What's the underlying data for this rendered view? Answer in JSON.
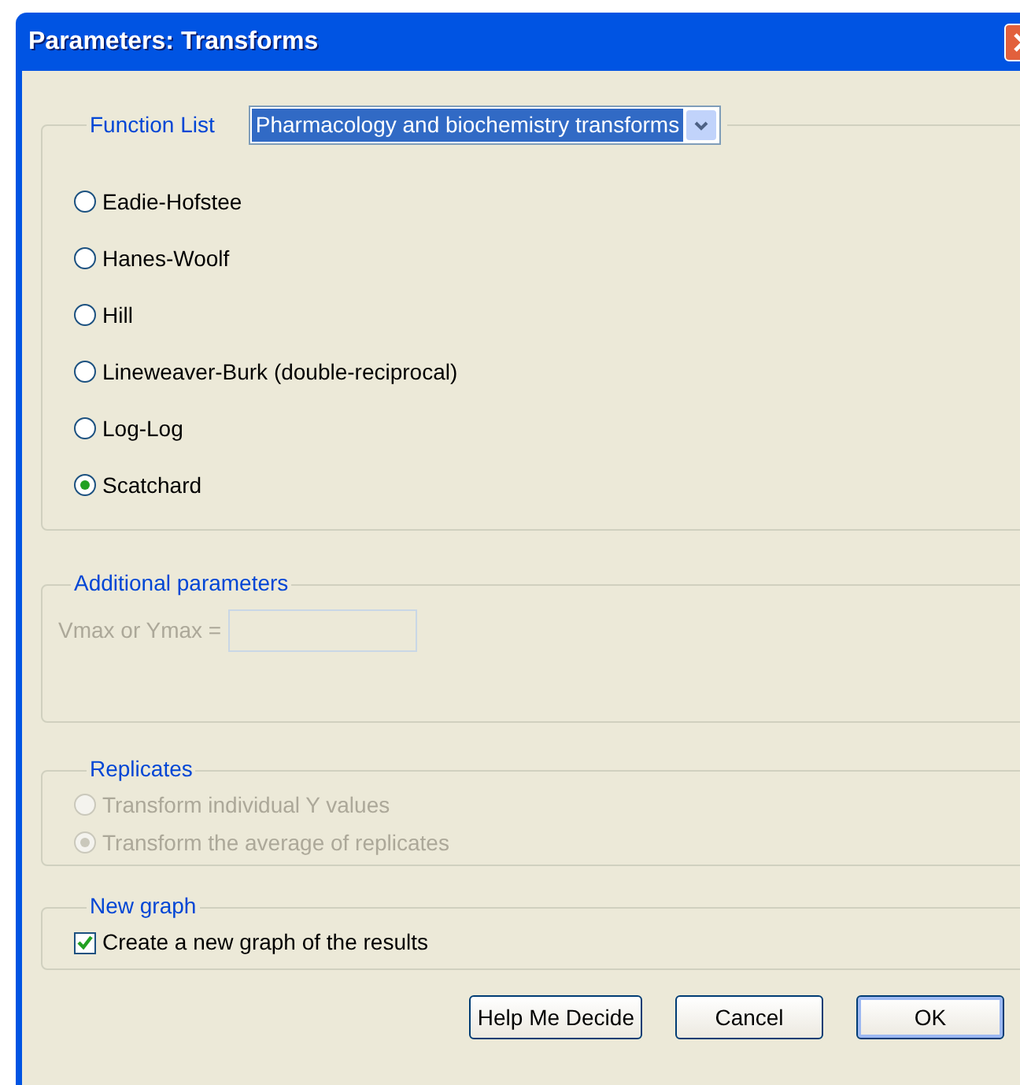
{
  "window": {
    "title": "Parameters: Transforms"
  },
  "function_list": {
    "label": "Function List",
    "value": "Pharmacology and biochemistry transforms"
  },
  "transforms": [
    {
      "label": "Eadie-Hofstee",
      "selected": false
    },
    {
      "label": "Hanes-Woolf",
      "selected": false
    },
    {
      "label": "Hill",
      "selected": false
    },
    {
      "label": "Lineweaver-Burk (double-reciprocal)",
      "selected": false
    },
    {
      "label": "Log-Log",
      "selected": false
    },
    {
      "label": "Scatchard",
      "selected": true
    }
  ],
  "additional_parameters": {
    "label": "Additional parameters",
    "field_label": "Vmax or Ymax =",
    "disabled": true
  },
  "replicates": {
    "label": "Replicates",
    "disabled": true,
    "options": [
      {
        "label": "Transform individual Y values",
        "selected": false
      },
      {
        "label": "Transform the average of replicates",
        "selected": true
      }
    ]
  },
  "new_graph": {
    "label": "New graph",
    "checkbox": {
      "label": "Create a new graph of the results",
      "checked": true
    }
  },
  "buttons": [
    {
      "label": "Help Me Decide",
      "default": false
    },
    {
      "label": "Cancel",
      "default": false
    },
    {
      "label": "OK",
      "default": true
    }
  ]
}
